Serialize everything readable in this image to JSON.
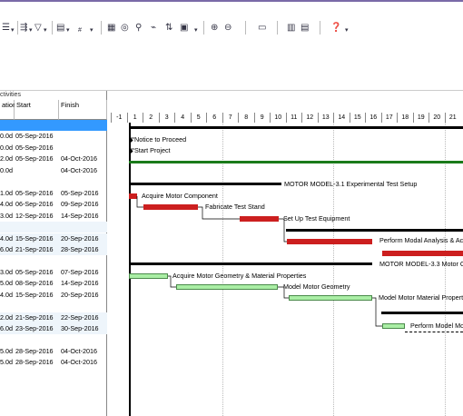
{
  "toolbar": {
    "icons": [
      "list-icon",
      "indent-icon",
      "filter-icon",
      "layout-icon",
      "sort-icon",
      "grid-icon",
      "find-icon",
      "link-icon",
      "split-icon",
      "resource-icon",
      "zoom-in-icon",
      "zoom-out-icon",
      "collapse-icon",
      "columns-icon",
      "help-icon"
    ]
  },
  "table": {
    "header_label": "ctivities",
    "col_duration": "ation",
    "col_start": "Start",
    "col_finish": "Finish",
    "rows": [
      {
        "dur": "",
        "start": "",
        "finish": "",
        "style": "sel"
      },
      {
        "dur": "0.0d",
        "start": "05-Sep-2016",
        "finish": "",
        "style": ""
      },
      {
        "dur": "0.0d",
        "start": "05-Sep-2016",
        "finish": "",
        "style": ""
      },
      {
        "dur": "2.0d",
        "start": "05-Sep-2016",
        "finish": "04-Oct-2016",
        "style": ""
      },
      {
        "dur": "0.0d",
        "start": "",
        "finish": "04-Oct-2016",
        "style": ""
      },
      {
        "dur": "",
        "start": "",
        "finish": "",
        "style": ""
      },
      {
        "dur": "1.0d",
        "start": "05-Sep-2016",
        "finish": "05-Sep-2016",
        "style": ""
      },
      {
        "dur": "4.0d",
        "start": "06-Sep-2016",
        "finish": "09-Sep-2016",
        "style": ""
      },
      {
        "dur": "3.0d",
        "start": "12-Sep-2016",
        "finish": "14-Sep-2016",
        "style": ""
      },
      {
        "dur": "",
        "start": "",
        "finish": "",
        "style": "alt"
      },
      {
        "dur": "4.0d",
        "start": "15-Sep-2016",
        "finish": "20-Sep-2016",
        "style": "alt"
      },
      {
        "dur": "6.0d",
        "start": "21-Sep-2016",
        "finish": "28-Sep-2016",
        "style": "alt"
      },
      {
        "dur": "",
        "start": "",
        "finish": "",
        "style": ""
      },
      {
        "dur": "3.0d",
        "start": "05-Sep-2016",
        "finish": "07-Sep-2016",
        "style": ""
      },
      {
        "dur": "5.0d",
        "start": "08-Sep-2016",
        "finish": "14-Sep-2016",
        "style": ""
      },
      {
        "dur": "4.0d",
        "start": "15-Sep-2016",
        "finish": "20-Sep-2016",
        "style": ""
      },
      {
        "dur": "",
        "start": "",
        "finish": "",
        "style": ""
      },
      {
        "dur": "2.0d",
        "start": "21-Sep-2016",
        "finish": "22-Sep-2016",
        "style": "alt"
      },
      {
        "dur": "6.0d",
        "start": "23-Sep-2016",
        "finish": "30-Sep-2016",
        "style": "alt"
      },
      {
        "dur": "",
        "start": "",
        "finish": "",
        "style": ""
      },
      {
        "dur": "5.0d",
        "start": "28-Sep-2016",
        "finish": "04-Oct-2016",
        "style": ""
      },
      {
        "dur": "5.0d",
        "start": "28-Sep-2016",
        "finish": "04-Oct-2016",
        "style": ""
      }
    ]
  },
  "gantt": {
    "ticks": [
      "-1",
      "1",
      "2",
      "3",
      "4",
      "5",
      "6",
      "7",
      "8",
      "9",
      "10",
      "11",
      "12",
      "13",
      "14",
      "15",
      "16",
      "17",
      "18",
      "19",
      "20",
      "21"
    ],
    "labels": {
      "notice": "Notice to Proceed",
      "start_project": "Start Project",
      "mm31": "MOTOR MODEL-3.1  Experimental Test Setup",
      "acquire_motor": "Acquire Motor Component",
      "fabricate": "Fabricate Test Stand",
      "setup": "Set Up Test Equipment",
      "perform": "Perform Modal Analysis & Ac",
      "mm33": "MOTOR MODEL-3.3  Motor Geometry",
      "acquire_geo": "Acquire Motor Geometry & Material Properties",
      "model_geo": "Model Motor Geometry",
      "model_mat": "Model Motor Material Propertie",
      "perform_model": "Perform Model Mo"
    },
    "colors": {
      "critical": "#cc1f1f",
      "normal": "#aaeea5",
      "summary": "#000000",
      "project": "#1a7a1a"
    }
  }
}
